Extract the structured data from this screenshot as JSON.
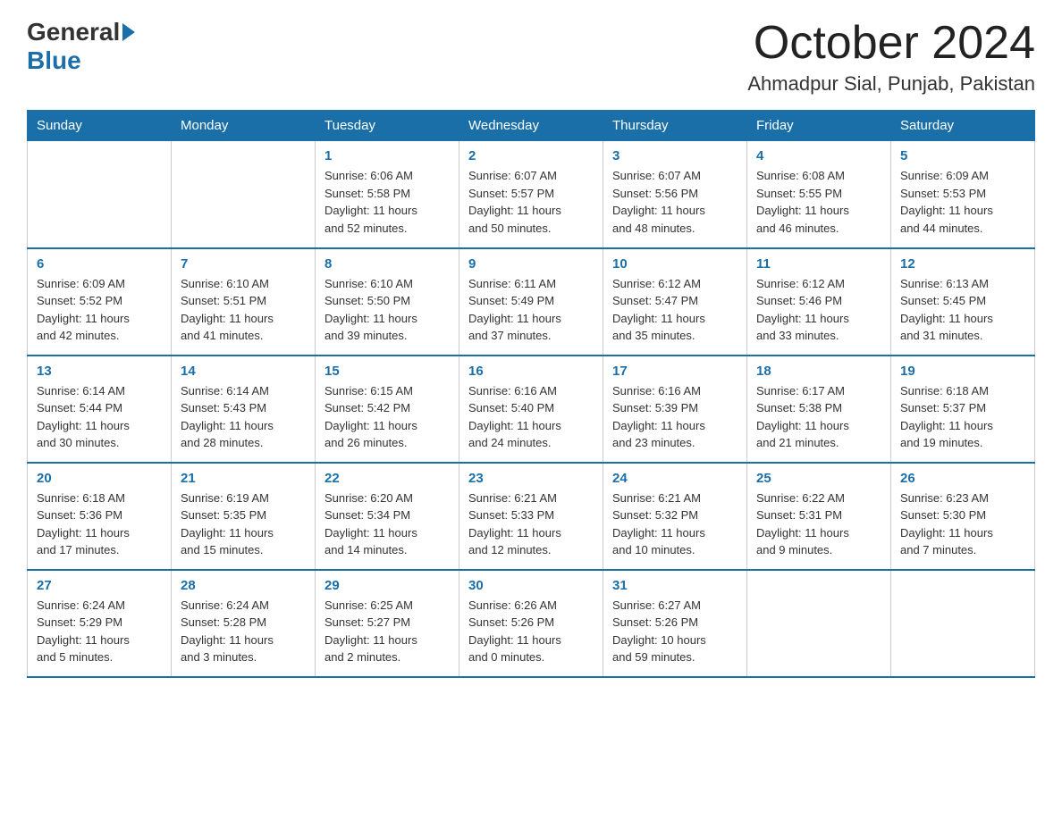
{
  "header": {
    "logo_general": "General",
    "logo_blue": "Blue",
    "month_title": "October 2024",
    "location": "Ahmadpur Sial, Punjab, Pakistan"
  },
  "days_of_week": [
    "Sunday",
    "Monday",
    "Tuesday",
    "Wednesday",
    "Thursday",
    "Friday",
    "Saturday"
  ],
  "weeks": [
    [
      {
        "day": "",
        "info": ""
      },
      {
        "day": "",
        "info": ""
      },
      {
        "day": "1",
        "info": "Sunrise: 6:06 AM\nSunset: 5:58 PM\nDaylight: 11 hours\nand 52 minutes."
      },
      {
        "day": "2",
        "info": "Sunrise: 6:07 AM\nSunset: 5:57 PM\nDaylight: 11 hours\nand 50 minutes."
      },
      {
        "day": "3",
        "info": "Sunrise: 6:07 AM\nSunset: 5:56 PM\nDaylight: 11 hours\nand 48 minutes."
      },
      {
        "day": "4",
        "info": "Sunrise: 6:08 AM\nSunset: 5:55 PM\nDaylight: 11 hours\nand 46 minutes."
      },
      {
        "day": "5",
        "info": "Sunrise: 6:09 AM\nSunset: 5:53 PM\nDaylight: 11 hours\nand 44 minutes."
      }
    ],
    [
      {
        "day": "6",
        "info": "Sunrise: 6:09 AM\nSunset: 5:52 PM\nDaylight: 11 hours\nand 42 minutes."
      },
      {
        "day": "7",
        "info": "Sunrise: 6:10 AM\nSunset: 5:51 PM\nDaylight: 11 hours\nand 41 minutes."
      },
      {
        "day": "8",
        "info": "Sunrise: 6:10 AM\nSunset: 5:50 PM\nDaylight: 11 hours\nand 39 minutes."
      },
      {
        "day": "9",
        "info": "Sunrise: 6:11 AM\nSunset: 5:49 PM\nDaylight: 11 hours\nand 37 minutes."
      },
      {
        "day": "10",
        "info": "Sunrise: 6:12 AM\nSunset: 5:47 PM\nDaylight: 11 hours\nand 35 minutes."
      },
      {
        "day": "11",
        "info": "Sunrise: 6:12 AM\nSunset: 5:46 PM\nDaylight: 11 hours\nand 33 minutes."
      },
      {
        "day": "12",
        "info": "Sunrise: 6:13 AM\nSunset: 5:45 PM\nDaylight: 11 hours\nand 31 minutes."
      }
    ],
    [
      {
        "day": "13",
        "info": "Sunrise: 6:14 AM\nSunset: 5:44 PM\nDaylight: 11 hours\nand 30 minutes."
      },
      {
        "day": "14",
        "info": "Sunrise: 6:14 AM\nSunset: 5:43 PM\nDaylight: 11 hours\nand 28 minutes."
      },
      {
        "day": "15",
        "info": "Sunrise: 6:15 AM\nSunset: 5:42 PM\nDaylight: 11 hours\nand 26 minutes."
      },
      {
        "day": "16",
        "info": "Sunrise: 6:16 AM\nSunset: 5:40 PM\nDaylight: 11 hours\nand 24 minutes."
      },
      {
        "day": "17",
        "info": "Sunrise: 6:16 AM\nSunset: 5:39 PM\nDaylight: 11 hours\nand 23 minutes."
      },
      {
        "day": "18",
        "info": "Sunrise: 6:17 AM\nSunset: 5:38 PM\nDaylight: 11 hours\nand 21 minutes."
      },
      {
        "day": "19",
        "info": "Sunrise: 6:18 AM\nSunset: 5:37 PM\nDaylight: 11 hours\nand 19 minutes."
      }
    ],
    [
      {
        "day": "20",
        "info": "Sunrise: 6:18 AM\nSunset: 5:36 PM\nDaylight: 11 hours\nand 17 minutes."
      },
      {
        "day": "21",
        "info": "Sunrise: 6:19 AM\nSunset: 5:35 PM\nDaylight: 11 hours\nand 15 minutes."
      },
      {
        "day": "22",
        "info": "Sunrise: 6:20 AM\nSunset: 5:34 PM\nDaylight: 11 hours\nand 14 minutes."
      },
      {
        "day": "23",
        "info": "Sunrise: 6:21 AM\nSunset: 5:33 PM\nDaylight: 11 hours\nand 12 minutes."
      },
      {
        "day": "24",
        "info": "Sunrise: 6:21 AM\nSunset: 5:32 PM\nDaylight: 11 hours\nand 10 minutes."
      },
      {
        "day": "25",
        "info": "Sunrise: 6:22 AM\nSunset: 5:31 PM\nDaylight: 11 hours\nand 9 minutes."
      },
      {
        "day": "26",
        "info": "Sunrise: 6:23 AM\nSunset: 5:30 PM\nDaylight: 11 hours\nand 7 minutes."
      }
    ],
    [
      {
        "day": "27",
        "info": "Sunrise: 6:24 AM\nSunset: 5:29 PM\nDaylight: 11 hours\nand 5 minutes."
      },
      {
        "day": "28",
        "info": "Sunrise: 6:24 AM\nSunset: 5:28 PM\nDaylight: 11 hours\nand 3 minutes."
      },
      {
        "day": "29",
        "info": "Sunrise: 6:25 AM\nSunset: 5:27 PM\nDaylight: 11 hours\nand 2 minutes."
      },
      {
        "day": "30",
        "info": "Sunrise: 6:26 AM\nSunset: 5:26 PM\nDaylight: 11 hours\nand 0 minutes."
      },
      {
        "day": "31",
        "info": "Sunrise: 6:27 AM\nSunset: 5:26 PM\nDaylight: 10 hours\nand 59 minutes."
      },
      {
        "day": "",
        "info": ""
      },
      {
        "day": "",
        "info": ""
      }
    ]
  ]
}
